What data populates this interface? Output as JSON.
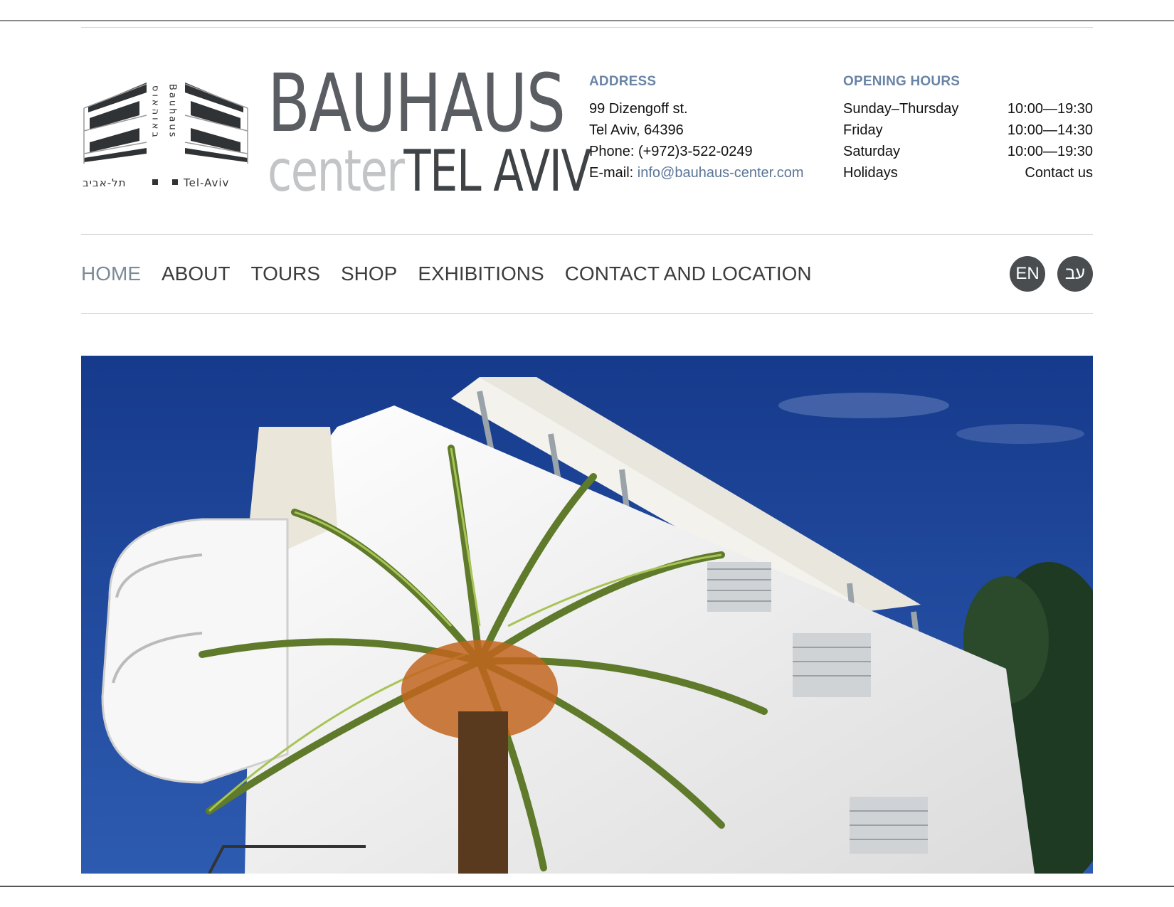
{
  "logo": {
    "hebrew_vertical": "באוהאוס",
    "latin_vertical": "Bauhaus",
    "hebrew_city": "תל-אביב",
    "latin_city": "Tel-Aviv",
    "wordmark_top": "BAUHAUS",
    "wordmark_center": "center",
    "wordmark_city": "TEL AVIV"
  },
  "address": {
    "heading": "ADDRESS",
    "street": "99 Dizengoff st.",
    "city": "Tel Aviv, 64396",
    "phone": "Phone: (+972)3-522-0249",
    "email_label": "E-mail: ",
    "email": "info@bauhaus-center.com"
  },
  "hours": {
    "heading": "OPENING HOURS",
    "rows": [
      {
        "day": "Sunday–Thursday",
        "time": "10:00—19:30"
      },
      {
        "day": "Friday",
        "time": "10:00—14:30"
      },
      {
        "day": "Saturday",
        "time": "10:00—19:30"
      },
      {
        "day": "Holidays",
        "time": "Contact us"
      }
    ]
  },
  "nav": {
    "items": [
      "HOME",
      "ABOUT",
      "TOURS",
      "SHOP",
      "EXHIBITIONS",
      "CONTACT AND LOCATION"
    ],
    "active": "HOME"
  },
  "language": {
    "en": "EN",
    "he": "עב"
  },
  "colors": {
    "accent": "#6a84a6",
    "link": "#5b7597",
    "nav_active": "#7b8b97",
    "lang_bg": "#4a4d50",
    "sky": "#1c3d8f"
  },
  "hero": {
    "icon": "bauhaus-building-photo"
  }
}
